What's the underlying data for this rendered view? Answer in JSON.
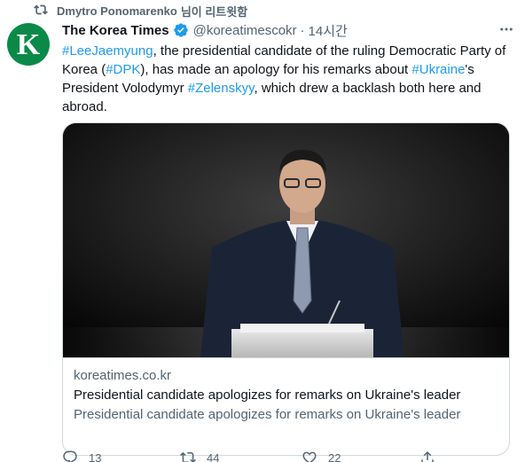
{
  "retweet_banner": {
    "retweeter": "Dmytro Ponomarenko",
    "suffix": "님이 리트윗함"
  },
  "author": {
    "avatar_letter": "K",
    "display_name": "The Korea Times",
    "handle": "@koreatimescokr",
    "separator": "·",
    "time": "14시간"
  },
  "tweet": {
    "segments": [
      {
        "text": "#LeeJaemyung",
        "tag": true
      },
      {
        "text": ", the presidential candidate of the ruling Democratic Party of Korea (",
        "tag": false
      },
      {
        "text": "#DPK",
        "tag": true
      },
      {
        "text": "), has made an apology for his remarks about ",
        "tag": false
      },
      {
        "text": "#Ukraine",
        "tag": true
      },
      {
        "text": "'s President Volodymyr ",
        "tag": false
      },
      {
        "text": "#Zelenskyy",
        "tag": true
      },
      {
        "text": ", which drew a backlash both here and abroad.",
        "tag": false
      }
    ]
  },
  "card": {
    "domain": "koreatimes.co.kr",
    "title": "Presidential candidate apologizes for remarks on Ukraine's leader",
    "description": "Presidential candidate apologizes for remarks on Ukraine's leader"
  },
  "actions": {
    "reply_count": "13",
    "retweet_count": "44",
    "like_count": "22"
  },
  "colors": {
    "link": "#1d9bf0",
    "secondary_text": "#536471",
    "avatar_bg": "#0a8a48",
    "verified": "#1d9bf0"
  },
  "icons": [
    "retweet-icon",
    "verified-badge-icon",
    "more-icon",
    "reply-icon",
    "retweet-icon",
    "like-icon",
    "share-icon"
  ]
}
